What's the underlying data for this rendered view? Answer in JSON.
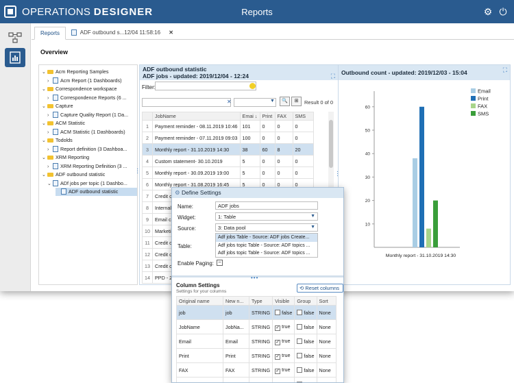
{
  "header": {
    "brand_light": "OPERATIONS ",
    "brand_bold": "DESIGNER",
    "title": "Reports",
    "gear_icon": "gear-icon",
    "power_icon": "power-icon"
  },
  "tabs": [
    {
      "label": "Reports"
    },
    {
      "label": "ADF outbound s...12/04 11:58:16",
      "close": "✕"
    }
  ],
  "overview_title": "Overview",
  "tree": [
    {
      "label": "Acm Reporting Samples",
      "type": "folder",
      "chevron": "⌄"
    },
    {
      "label": "Acm Report (1 Dashboards)",
      "type": "report",
      "chevron": "›"
    },
    {
      "label": "Correspondence workspace",
      "type": "folder",
      "chevron": "⌄"
    },
    {
      "label": "Correspondence Reports (6 ...",
      "type": "report",
      "chevron": "›"
    },
    {
      "label": "Capture",
      "type": "folder",
      "chevron": "⌄"
    },
    {
      "label": "Capture Quality Report (1 Da...",
      "type": "report",
      "chevron": "›"
    },
    {
      "label": "ACM Statistic",
      "type": "folder",
      "chevron": "⌄"
    },
    {
      "label": "ACM Statistic (1 Dashboards)",
      "type": "report",
      "chevron": "›"
    },
    {
      "label": "Todolds",
      "type": "folder",
      "chevron": "⌄"
    },
    {
      "label": "Report definition (3 Dashboa...",
      "type": "report",
      "chevron": "›"
    },
    {
      "label": "XRM Reporting",
      "type": "folder",
      "chevron": "⌄"
    },
    {
      "label": "XRM Reporting Definition (3 ...",
      "type": "report",
      "chevron": "›"
    },
    {
      "label": "ADF outbound statistic",
      "type": "folder",
      "chevron": "⌄"
    },
    {
      "label": "ADf jobs per topic (1 Dashbo...",
      "type": "report",
      "chevron": "⌄"
    },
    {
      "label": "ADF outbound statistic",
      "type": "report",
      "chevron": ""
    }
  ],
  "adf": {
    "title": "ADF outbound statistic",
    "subtitle": "ADF jobs - updated: 2019/12/04 - 12:24",
    "filter_label": "Filter:",
    "result": "Result 0 of 0",
    "columns": [
      "JobName",
      "Emai ↓",
      "Print",
      "FAX",
      "SMS"
    ],
    "rows": [
      [
        "1",
        "Payment reminder - 08.11.2019 10:46",
        "101",
        "0",
        "0",
        "0"
      ],
      [
        "2",
        "Payment reminder - 07.11.2019 09:03",
        "100",
        "0",
        "0",
        "0"
      ],
      [
        "3",
        "Monthly report - 31.10.2019 14:30",
        "38",
        "60",
        "8",
        "20"
      ],
      [
        "4",
        "Custom statement- 30.10.2019",
        "5",
        "0",
        "0",
        "0"
      ],
      [
        "5",
        "Monthly report - 30.09.2019 19:00",
        "5",
        "0",
        "0",
        "0"
      ],
      [
        "6",
        "Monthly report - 31.08.2019 16:45",
        "5",
        "0",
        "0",
        "0"
      ],
      [
        "7",
        "Credit o",
        "",
        "",
        "",
        ""
      ],
      [
        "8",
        "Internal",
        "",
        "",
        "",
        ""
      ],
      [
        "9",
        "Email ca",
        "",
        "",
        "",
        ""
      ],
      [
        "10",
        "Marketi",
        "",
        "",
        "",
        ""
      ],
      [
        "11",
        "Credit o",
        "",
        "",
        "",
        ""
      ],
      [
        "12",
        "Credit o",
        "",
        "",
        "",
        ""
      ],
      [
        "13",
        "Credit o",
        "",
        "",
        "",
        ""
      ],
      [
        "14",
        "PPD - 2",
        "",
        "",
        "",
        ""
      ]
    ]
  },
  "chart_panel_title": "Outbound count - updated: 2019/12/03 - 15:04",
  "chart_data": {
    "type": "bar",
    "categories": [
      "Monthly report - 31.10.2019 14:30"
    ],
    "series": [
      {
        "name": "Email",
        "values": [
          38
        ],
        "color": "#a9cde4"
      },
      {
        "name": "Print",
        "values": [
          60
        ],
        "color": "#1f6fb5"
      },
      {
        "name": "FAX",
        "values": [
          8
        ],
        "color": "#a8d58a"
      },
      {
        "name": "SMS",
        "values": [
          20
        ],
        "color": "#3a9e3a"
      }
    ],
    "ylim": [
      0,
      60
    ],
    "yticks": [
      "60",
      "50",
      "40",
      "30",
      "20",
      "10"
    ],
    "legend": "top-right"
  },
  "dialog": {
    "title": "Define Settings",
    "name_label": "Name:",
    "name_value": "ADF jobs",
    "widget_label": "Widget:",
    "widget_value": "1: Table",
    "source_label": "Source:",
    "source_value": "3: Data pool",
    "table_label": "Table:",
    "table_options": [
      "Adf jobs Table - Source: ADF jobs Create...",
      "Adf jobs topic Table - Source: ADF topics ...",
      "Adf jobs topic Table - Source: ADF topics ..."
    ],
    "paging_label": "Enable Paging:",
    "paging_symbol": "−",
    "column_settings_title": "Column Settings",
    "column_settings_sub": "Settings for your columns",
    "reset_label": "Reset columns",
    "col_headers": [
      "Original name",
      "New n...",
      "Type",
      "Visible",
      "Group",
      "Sort"
    ],
    "col_rows": [
      [
        "job",
        "job",
        "STRING",
        "false",
        "false",
        "None"
      ],
      [
        "JobName",
        "JobNa...",
        "STRING",
        "true",
        "false",
        "None"
      ],
      [
        "Email",
        "Email",
        "STRING",
        "true",
        "false",
        "None"
      ],
      [
        "Print",
        "Print",
        "STRING",
        "true",
        "false",
        "None"
      ],
      [
        "FAX",
        "FAX",
        "STRING",
        "true",
        "false",
        "None"
      ],
      [
        "SMS",
        "SMS",
        "STRING",
        "true",
        "false",
        "None"
      ]
    ]
  }
}
